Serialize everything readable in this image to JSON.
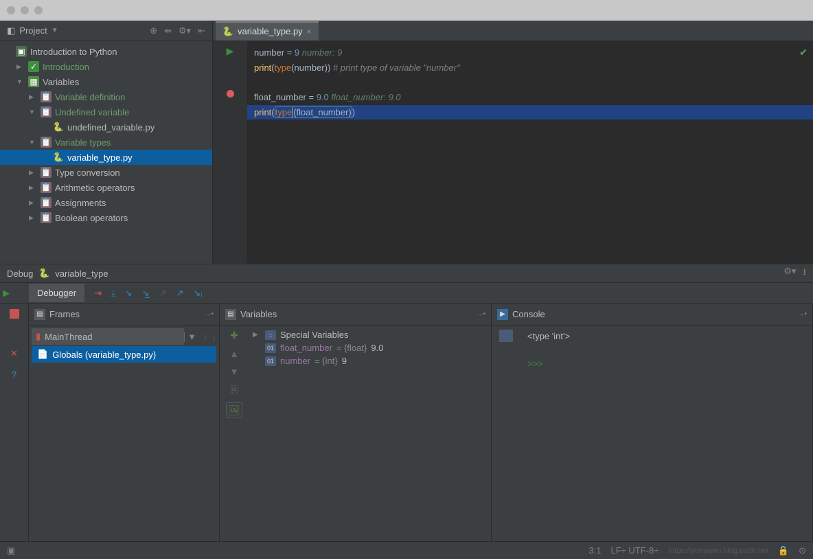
{
  "project": {
    "header": "Project",
    "root": "Introduction to Python",
    "items": [
      {
        "depth": 0,
        "arrow": "",
        "icon": "folder",
        "text": "Introduction to Python",
        "green": false
      },
      {
        "depth": 1,
        "arrow": "▶",
        "icon": "check",
        "text": "Introduction",
        "green": true
      },
      {
        "depth": 1,
        "arrow": "▼",
        "icon": "lesson",
        "text": "Variables",
        "green": false
      },
      {
        "depth": 2,
        "arrow": "▶",
        "icon": "clip",
        "text": "Variable definition",
        "green": true
      },
      {
        "depth": 2,
        "arrow": "▼",
        "icon": "clip",
        "text": "Undefined variable",
        "green": true
      },
      {
        "depth": 3,
        "arrow": "",
        "icon": "py",
        "text": "undefined_variable.py",
        "green": false
      },
      {
        "depth": 2,
        "arrow": "▼",
        "icon": "clip",
        "text": "Variable types",
        "green": true
      },
      {
        "depth": 3,
        "arrow": "",
        "icon": "py",
        "text": "variable_type.py",
        "green": false,
        "sel": true
      },
      {
        "depth": 2,
        "arrow": "▶",
        "icon": "clip",
        "text": "Type conversion",
        "green": false
      },
      {
        "depth": 2,
        "arrow": "▶",
        "icon": "clip",
        "text": "Arithmetic operators",
        "green": false
      },
      {
        "depth": 2,
        "arrow": "▶",
        "icon": "clip",
        "text": "Assignments",
        "green": false
      },
      {
        "depth": 2,
        "arrow": "▶",
        "icon": "clip",
        "text": "Boolean operators",
        "green": false
      }
    ]
  },
  "editor": {
    "tab": "variable_type.py",
    "lines": {
      "l1a": "number",
      "l1b": " = ",
      "l1c": "9",
      "l1d": "   number: 9",
      "l2a": "print",
      "l2b": "(",
      "l2c": "type",
      "l2d": "(number))",
      "l2e": "   # print type of variable \"number\"",
      "l3": "",
      "l4a": "float_number",
      "l4b": " = ",
      "l4c": "9.0",
      "l4d": "   float_number: 9.0",
      "l5a": "print",
      "l5b": "(",
      "l5c": "type",
      "l5d": "(float_number)",
      "l5e": ")"
    }
  },
  "debug": {
    "title": "Debug",
    "target": "variable_type",
    "tab": "Debugger",
    "frames": {
      "title": "Frames",
      "thread": "MainThread",
      "globals": "Globals (variable_type.py)"
    },
    "variables": {
      "title": "Variables",
      "special": "Special Variables",
      "rows": [
        {
          "name": "float_number",
          "type": "{float}",
          "val": "9.0"
        },
        {
          "name": "number",
          "type": "{int}",
          "val": "9"
        }
      ]
    },
    "console": {
      "title": "Console",
      "output": "<type 'int'>",
      "prompt": ">>>"
    }
  },
  "status": {
    "pos": "3:1",
    "enc": "LF÷  UTF-8÷",
    "watermark": "https://yunyaniu.blog.csdn.net"
  }
}
